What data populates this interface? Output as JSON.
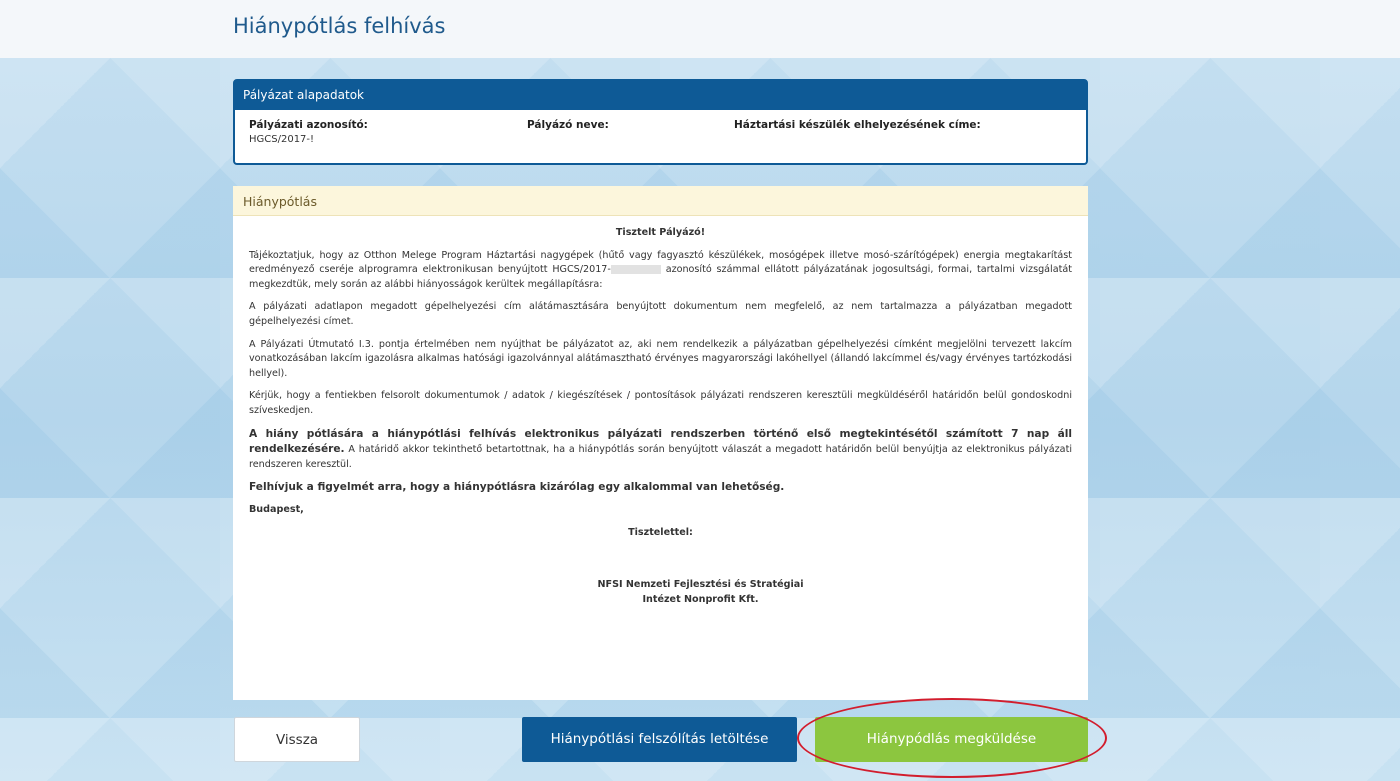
{
  "page": {
    "title": "Hiánypótlás felhívás"
  },
  "basic_panel": {
    "header": "Pályázat alapadatok",
    "id_label": "Pályázati azonosító:",
    "id_value": "HGCS/2017-!",
    "name_label": "Pályázó neve:",
    "address_label": "Háztartási készülék elhelyezésének címe:"
  },
  "hp_panel": {
    "header": "Hiánypótlás",
    "greeting": "Tisztelt Pályázó!",
    "para1_a": "Tájékoztatjuk, hogy az Otthon Melege Program Háztartási nagygépek (hűtő vagy fagyasztó készülékek, mosógépek illetve mosó-szárítógépek) energia megtakarítást eredményező cseréje alprogramra elektronikusan benyújtott HGCS/2017-",
    "para1_b": " azonosító számmal ellátott pályázatának jogosultsági, formai, tartalmi vizsgálatát megkezdtük, mely során az alábbi hiányosságok kerültek megállapításra:",
    "para2": "A pályázati adatlapon megadott gépelhelyezési cím alátámasztására benyújtott dokumentum nem megfelelő, az nem tartalmazza a pályázatban megadott gépelhelyezési címet.",
    "para3": "A Pályázati Útmutató I.3. pontja értelmében nem nyújthat be pályázatot az, aki nem rendelkezik a pályázatban gépelhelyezési címként megjelölni tervezett lakcím vonatkozásában lakcím igazolásra alkalmas hatósági igazolvánnyal alátámasztható érvényes magyarországi lakóhellyel (állandó lakcímmel és/vagy érvényes tartózkodási hellyel).",
    "para4": "Kérjük, hogy a fentiekben felsorolt dokumentumok / adatok / kiegészítések / pontosítások pályázati rendszeren keresztüli megküldéséről határidőn belül gondoskodni szíveskedjen.",
    "para5_bold": "A hiány pótlására a hiánypótlási felhívás elektronikus pályázati rendszerben történő első megtekintésétől számított 7 nap áll rendelkezésére.",
    "para5_rest": " A határidő akkor tekinthető betartottnak, ha a hiánypótlás során benyújtott válaszát a megadott határidőn belül benyújtja az elektronikus pályázati rendszeren keresztül.",
    "para6": "Felhívjuk a figyelmét arra, hogy a hiánypótlásra kizárólag egy alkalommal van lehetőség.",
    "city": "Budapest,",
    "closing": "Tisztelettel:",
    "signer_line1": "NFSI Nemzeti Fejlesztési és Stratégiai",
    "signer_line2": "Intézet Nonprofit Kft."
  },
  "buttons": {
    "back": "Vissza",
    "download": "Hiánypótlási felszólítás letöltése",
    "send": "Hiánypódlás megküldése"
  },
  "highlight_color": "#d21d2d"
}
